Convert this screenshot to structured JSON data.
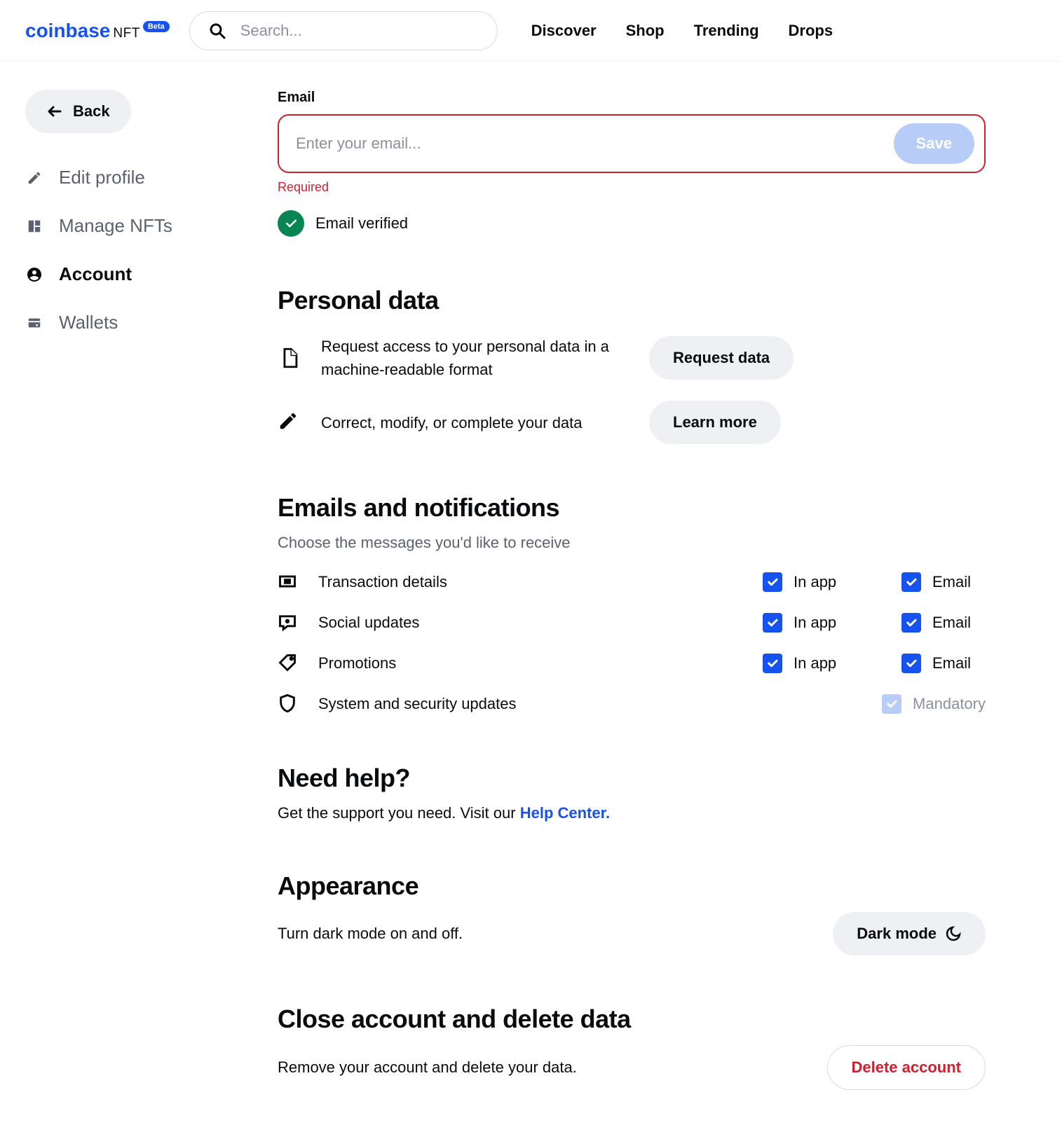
{
  "header": {
    "logo_main": "coinbase",
    "logo_sub": "NFT",
    "beta": "Beta",
    "search_placeholder": "Search...",
    "nav": [
      "Discover",
      "Shop",
      "Trending",
      "Drops"
    ]
  },
  "sidebar": {
    "back": "Back",
    "items": [
      {
        "label": "Edit profile",
        "icon": "pencil"
      },
      {
        "label": "Manage NFTs",
        "icon": "grid"
      },
      {
        "label": "Account",
        "icon": "user-circle",
        "active": true
      },
      {
        "label": "Wallets",
        "icon": "wallet"
      }
    ]
  },
  "email_section": {
    "label": "Email",
    "placeholder": "Enter your email...",
    "save": "Save",
    "error": "Required",
    "verified": "Email verified"
  },
  "personal": {
    "heading": "Personal data",
    "request_text": "Request access to your personal data in a machine-readable format",
    "request_btn": "Request data",
    "modify_text": "Correct, modify, or complete your data",
    "modify_btn": "Learn more"
  },
  "notifications": {
    "heading": "Emails and notifications",
    "subtitle": "Choose the messages you'd like to receive",
    "col_inapp": "In app",
    "col_email": "Email",
    "mandatory": "Mandatory",
    "rows": [
      {
        "label": "Transaction details",
        "icon": "transaction"
      },
      {
        "label": "Social updates",
        "icon": "social"
      },
      {
        "label": "Promotions",
        "icon": "tag"
      },
      {
        "label": "System and security updates",
        "icon": "shield",
        "mandatory": true
      }
    ]
  },
  "help": {
    "heading": "Need help?",
    "text": "Get the support you need. Visit our ",
    "link": "Help Center."
  },
  "appearance": {
    "heading": "Appearance",
    "text": "Turn dark mode on and off.",
    "btn": "Dark mode"
  },
  "close": {
    "heading": "Close account and delete data",
    "text": "Remove your account and delete your data.",
    "btn": "Delete account"
  }
}
